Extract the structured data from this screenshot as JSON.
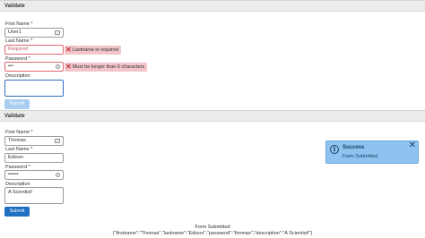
{
  "form1": {
    "header": "Validate",
    "first_name_label": "First Name *",
    "first_name_value": "User1",
    "last_name_label": "Last Name *",
    "last_name_placeholder": "Required",
    "last_name_error": "Lastname is required",
    "password_label": "Password *",
    "password_value": "•••",
    "password_error": "Must be longer than 6 characters",
    "description_label": "Description",
    "description_value": "",
    "submit_label": "Submit"
  },
  "form2": {
    "header": "Validate",
    "first_name_label": "First Name *",
    "first_name_value": "Thomas",
    "last_name_label": "Last Name *",
    "last_name_value": "Edison",
    "password_label": "Password *",
    "password_value": "••••••",
    "description_label": "Description",
    "description_value": "A Scientist!",
    "submit_label": "Submit"
  },
  "toast": {
    "icon": "info-icon",
    "title": "Success",
    "message": "Form Submitted",
    "close": "✕"
  },
  "result": {
    "line1": "Form Submitted",
    "line2": "{\"firstname\":\"Thomas\",\"lastname\":\"Edison\",\"password\":\"thomas\",\"description\":\"A Scientist!\"}"
  },
  "colors": {
    "error_bg": "#f3c4c9",
    "error_x": "#c2323e",
    "primary": "#1f6fc2",
    "toast_bg": "#8ec2ef"
  }
}
